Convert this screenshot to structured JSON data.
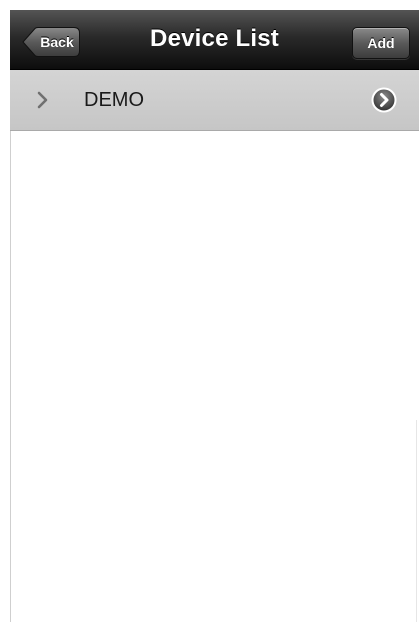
{
  "nav": {
    "title": "Device List",
    "back_label": "Back",
    "add_label": "Add"
  },
  "devices": [
    {
      "name": "DEMO"
    }
  ],
  "icons": {
    "row_expand": "chevron-right-icon",
    "row_detail": "detail-disclosure-icon"
  },
  "colors": {
    "nav_bar": "#1c1c1c",
    "row_background": "#cccccc",
    "page_background": "#ffffff"
  }
}
